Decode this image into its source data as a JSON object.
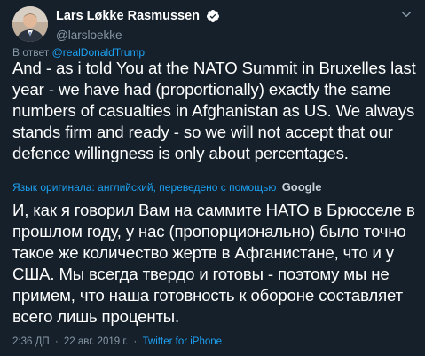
{
  "author": {
    "display_name": "Lars Løkke Rasmussen",
    "handle": "@larsloekke",
    "verified": true
  },
  "reply": {
    "prefix": "В ответ",
    "to": "@realDonaldTrump"
  },
  "tweet": {
    "text_original": "And - as i told You at the NATO Summit in Bruxelles last year - we have had (proportionally) exactly the same numbers of casualties in Afghanistan as US. We always stands firm and ready - so we will not accept that our defence willingness is only about percentages.",
    "translation_notice": "Язык оригинала: английский, переведено с помощью",
    "translation_provider": "Google",
    "text_translated": "И, как я говорил Вам на саммите НАТО в Брюсселе в прошлом году, у нас (пропорционально) было точно такое же количество жертв в Афганистане, что и у США. Мы всегда твердо и готовы - поэтому мы не примем, что наша готовность к обороне составляет всего лишь проценты."
  },
  "meta": {
    "time": "2:36 ДП",
    "separator": "·",
    "date": "22 авг. 2019 г.",
    "source": "Twitter for iPhone"
  },
  "icons": {
    "verified": "verified-badge-icon",
    "menu": "chevron-down-icon"
  },
  "colors": {
    "background": "#15202b",
    "accent": "#1da1f2",
    "secondary_text": "#8899a6"
  }
}
